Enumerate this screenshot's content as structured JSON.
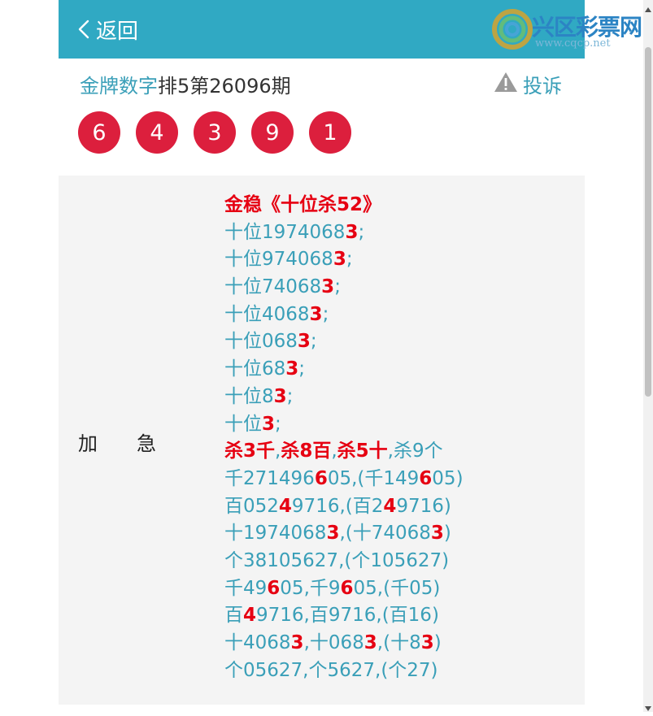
{
  "header": {
    "back_label": "返回"
  },
  "title": {
    "brand": "金牌数字",
    "rest": "排5第26096期"
  },
  "complain_label": "投诉",
  "balls": [
    "6",
    "4",
    "3",
    "9",
    "1"
  ],
  "label": {
    "a": "加",
    "b": "急"
  },
  "logo": {
    "text": "兴区彩票网",
    "sub": "www.cqcp.net"
  },
  "lines": [
    {
      "segs": [
        {
          "t": "金稳《十位杀52》",
          "h": true
        }
      ]
    },
    {
      "segs": [
        {
          "t": "十位1974068",
          "h": false
        },
        {
          "t": "3",
          "h": true
        },
        {
          "t": ";",
          "h": false
        }
      ]
    },
    {
      "segs": [
        {
          "t": "十位974068",
          "h": false
        },
        {
          "t": "3",
          "h": true
        },
        {
          "t": ";",
          "h": false
        }
      ]
    },
    {
      "segs": [
        {
          "t": "十位74068",
          "h": false
        },
        {
          "t": "3",
          "h": true
        },
        {
          "t": ";",
          "h": false
        }
      ]
    },
    {
      "segs": [
        {
          "t": "十位4068",
          "h": false
        },
        {
          "t": "3",
          "h": true
        },
        {
          "t": ";",
          "h": false
        }
      ]
    },
    {
      "segs": [
        {
          "t": "十位068",
          "h": false
        },
        {
          "t": "3",
          "h": true
        },
        {
          "t": ";",
          "h": false
        }
      ]
    },
    {
      "segs": [
        {
          "t": "十位68",
          "h": false
        },
        {
          "t": "3",
          "h": true
        },
        {
          "t": ";",
          "h": false
        }
      ]
    },
    {
      "segs": [
        {
          "t": "十位8",
          "h": false
        },
        {
          "t": "3",
          "h": true
        },
        {
          "t": ";",
          "h": false
        }
      ]
    },
    {
      "segs": [
        {
          "t": "十位",
          "h": false
        },
        {
          "t": "3",
          "h": true
        },
        {
          "t": ";",
          "h": false
        }
      ]
    },
    {
      "segs": [
        {
          "t": "杀3千",
          "h": true
        },
        {
          "t": ",",
          "h": false
        },
        {
          "t": "杀8百",
          "h": true
        },
        {
          "t": ",",
          "h": false
        },
        {
          "t": "杀5十",
          "h": true
        },
        {
          "t": ",杀9个",
          "h": false
        }
      ]
    },
    {
      "segs": [
        {
          "t": "千271496",
          "h": false
        },
        {
          "t": "6",
          "h": true
        },
        {
          "t": "05,(千149",
          "h": false
        },
        {
          "t": "6",
          "h": true
        },
        {
          "t": "05)",
          "h": false
        }
      ]
    },
    {
      "segs": [
        {
          "t": "百052",
          "h": false
        },
        {
          "t": "4",
          "h": true
        },
        {
          "t": "9716,(百2",
          "h": false
        },
        {
          "t": "4",
          "h": true
        },
        {
          "t": "9716)",
          "h": false
        }
      ]
    },
    {
      "segs": [
        {
          "t": "十1974068",
          "h": false
        },
        {
          "t": "3",
          "h": true
        },
        {
          "t": ",(十74068",
          "h": false
        },
        {
          "t": "3",
          "h": true
        },
        {
          "t": ")",
          "h": false
        }
      ]
    },
    {
      "segs": [
        {
          "t": "个38105627,(个105627)",
          "h": false
        }
      ]
    },
    {
      "segs": [
        {
          "t": "千49",
          "h": false
        },
        {
          "t": "6",
          "h": true
        },
        {
          "t": "05,千9",
          "h": false
        },
        {
          "t": "6",
          "h": true
        },
        {
          "t": "05,(千05)",
          "h": false
        }
      ]
    },
    {
      "segs": [
        {
          "t": "百",
          "h": false
        },
        {
          "t": "4",
          "h": true
        },
        {
          "t": "9716,百9716,(百16)",
          "h": false
        }
      ]
    },
    {
      "segs": [
        {
          "t": "十4068",
          "h": false
        },
        {
          "t": "3",
          "h": true
        },
        {
          "t": ",十068",
          "h": false
        },
        {
          "t": "3",
          "h": true
        },
        {
          "t": ",(十8",
          "h": false
        },
        {
          "t": "3",
          "h": true
        },
        {
          "t": ")",
          "h": false
        }
      ]
    },
    {
      "segs": [
        {
          "t": "个05627,个5627,(个27)",
          "h": false
        }
      ]
    }
  ]
}
